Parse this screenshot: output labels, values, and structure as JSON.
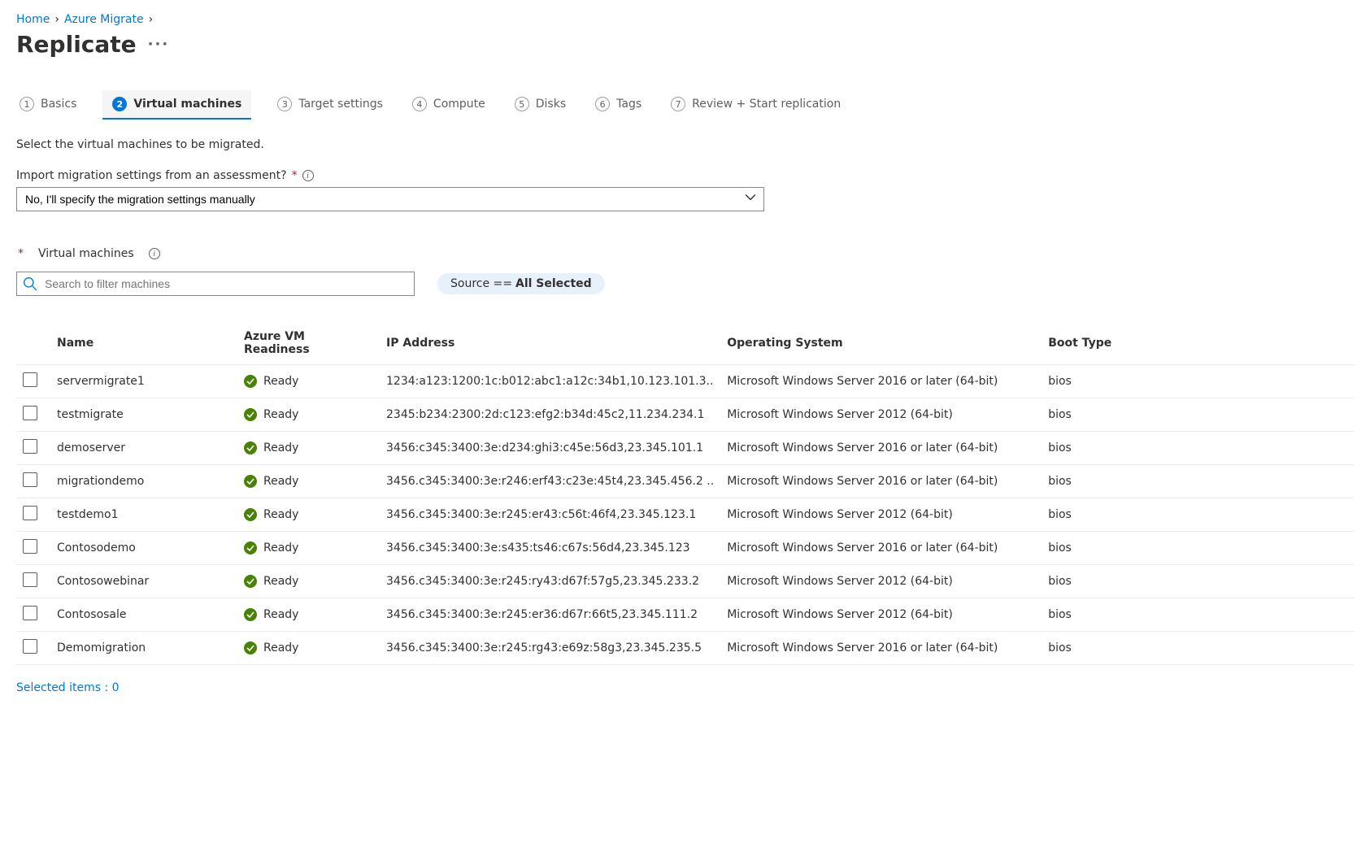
{
  "breadcrumb": {
    "home": "Home",
    "migrate": "Azure Migrate"
  },
  "page": {
    "title": "Replicate"
  },
  "tabs": [
    {
      "num": "1",
      "label": "Basics"
    },
    {
      "num": "2",
      "label": "Virtual machines"
    },
    {
      "num": "3",
      "label": "Target settings"
    },
    {
      "num": "4",
      "label": "Compute"
    },
    {
      "num": "5",
      "label": "Disks"
    },
    {
      "num": "6",
      "label": "Tags"
    },
    {
      "num": "7",
      "label": "Review + Start replication"
    }
  ],
  "section": {
    "help": "Select the virtual machines to be migrated.",
    "import_label": "Import migration settings from an assessment?",
    "import_value": "No, I'll specify the migration settings manually",
    "vm_label": "Virtual machines"
  },
  "search": {
    "placeholder": "Search to filter machines"
  },
  "filter": {
    "label": "Source ==",
    "value": "All Selected"
  },
  "table": {
    "headers": {
      "name": "Name",
      "readiness": "Azure VM Readiness",
      "ip": "IP Address",
      "os": "Operating System",
      "boot": "Boot Type"
    },
    "rows": [
      {
        "name": "servermigrate1",
        "ready": "Ready",
        "ip": "1234:a123:1200:1c:b012:abc1:a12c:34b1,10.123.101.3..",
        "os": "Microsoft Windows Server 2016 or later (64-bit)",
        "boot": "bios"
      },
      {
        "name": "testmigrate",
        "ready": "Ready",
        "ip": "2345:b234:2300:2d:c123:efg2:b34d:45c2,11.234.234.1",
        "os": "Microsoft Windows Server 2012 (64-bit)",
        "boot": "bios"
      },
      {
        "name": "demoserver",
        "ready": "Ready",
        "ip": "3456:c345:3400:3e:d234:ghi3:c45e:56d3,23.345.101.1",
        "os": "Microsoft Windows Server 2016 or later (64-bit)",
        "boot": "bios"
      },
      {
        "name": "migrationdemo",
        "ready": "Ready",
        "ip": "3456.c345:3400:3e:r246:erf43:c23e:45t4,23.345.456.2 ..",
        "os": "Microsoft Windows Server 2016 or later (64-bit)",
        "boot": "bios"
      },
      {
        "name": "testdemo1",
        "ready": "Ready",
        "ip": "3456.c345:3400:3e:r245:er43:c56t:46f4,23.345.123.1",
        "os": "Microsoft Windows Server 2012 (64-bit)",
        "boot": "bios"
      },
      {
        "name": "Contosodemo",
        "ready": "Ready",
        "ip": "3456.c345:3400:3e:s435:ts46:c67s:56d4,23.345.123",
        "os": "Microsoft Windows Server 2016 or later (64-bit)",
        "boot": "bios"
      },
      {
        "name": "Contosowebinar",
        "ready": "Ready",
        "ip": "3456.c345:3400:3e:r245:ry43:d67f:57g5,23.345.233.2",
        "os": "Microsoft Windows Server 2012 (64-bit)",
        "boot": "bios"
      },
      {
        "name": "Contososale",
        "ready": "Ready",
        "ip": "3456.c345:3400:3e:r245:er36:d67r:66t5,23.345.111.2",
        "os": "Microsoft Windows Server 2012 (64-bit)",
        "boot": "bios"
      },
      {
        "name": "Demomigration",
        "ready": "Ready",
        "ip": "3456.c345:3400:3e:r245:rg43:e69z:58g3,23.345.235.5",
        "os": "Microsoft Windows Server 2016 or later (64-bit)",
        "boot": "bios"
      }
    ]
  },
  "footer": {
    "selected": "Selected items : 0"
  }
}
